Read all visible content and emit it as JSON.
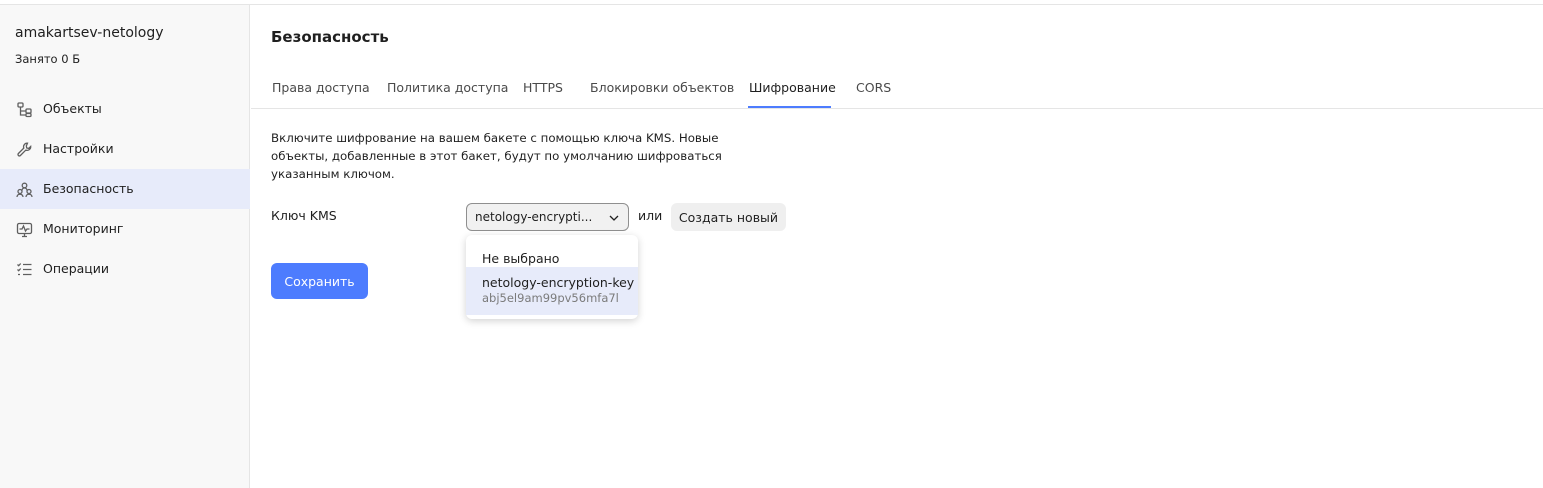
{
  "sidebar": {
    "bucket_name": "amakartsev-netology",
    "usage": "Занято 0 Б",
    "items": [
      {
        "label": "Объекты",
        "icon": "objects-icon",
        "active": false
      },
      {
        "label": "Настройки",
        "icon": "wrench-icon",
        "active": false
      },
      {
        "label": "Безопасность",
        "icon": "users-icon",
        "active": true
      },
      {
        "label": "Мониторинг",
        "icon": "monitoring-icon",
        "active": false
      },
      {
        "label": "Операции",
        "icon": "operations-list-icon",
        "active": false
      }
    ]
  },
  "main": {
    "title": "Безопасность",
    "tabs": [
      {
        "label": "Права доступа",
        "active": false
      },
      {
        "label": "Политика доступа",
        "active": false
      },
      {
        "label": "HTTPS",
        "active": false
      },
      {
        "label": "Блокировки объектов",
        "active": false
      },
      {
        "label": "Шифрование",
        "active": true
      },
      {
        "label": "CORS",
        "active": false
      }
    ],
    "description": "Включите шифрование на вашем бакете с помощью ключа KMS. Новые объекты, добавленные в этот бакет, будут по умолчанию шифроваться указанным ключом.",
    "kms_label": "Ключ KMS",
    "kms_select_value": "netology-encrypti...",
    "or_text": "или",
    "create_new_label": "Создать новый",
    "save_label": "Сохранить",
    "dropdown": {
      "none_option": "Не выбрано",
      "key_option": {
        "name": "netology-encryption-key",
        "id": "abj5el9am99pv56mfa7l"
      }
    }
  },
  "colors": {
    "accent": "#4d7cfe",
    "active_bg": "#e7ebfa",
    "sidebar_bg": "#f8f8f8"
  }
}
